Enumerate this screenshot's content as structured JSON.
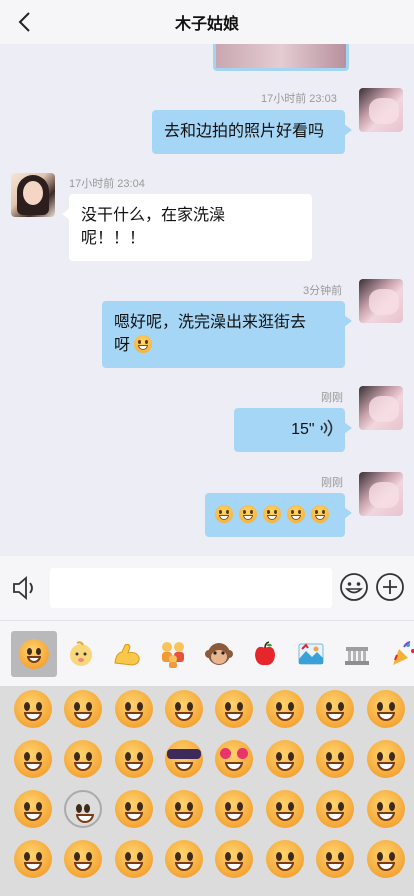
{
  "header": {
    "title": "木子姑娘"
  },
  "messages": [
    {
      "side": "right",
      "time": "17小时前 23:03",
      "text": "去和边拍的照片好看吗"
    },
    {
      "side": "left",
      "time": "17小时前 23:04",
      "text_line1": "没干什么，在家洗澡",
      "text_line2": "呢！！！"
    },
    {
      "side": "right",
      "time": "3分钟前",
      "text_line1": "嗯好呢，洗完澡出来逛街去",
      "text_line2": "呀"
    },
    {
      "side": "right",
      "time": "刚刚",
      "duration": "15\""
    },
    {
      "side": "right",
      "time": "刚刚",
      "emoji_count": 5
    }
  ],
  "input": {
    "value": "",
    "placeholder": ""
  },
  "icons": {
    "back": "chevron-left-icon",
    "voice": "speaker-icon",
    "emoji": "smiley-icon",
    "more": "plus-circle-icon"
  },
  "emoji_tabs": [
    "smileys",
    "baby",
    "arm",
    "family",
    "monkey",
    "apple",
    "landscape",
    "building",
    "party"
  ],
  "active_tab": 0,
  "colors": {
    "bubble_mine": "#a6d6f5",
    "bubble_theirs": "#ffffff",
    "background": "#ededf5"
  }
}
